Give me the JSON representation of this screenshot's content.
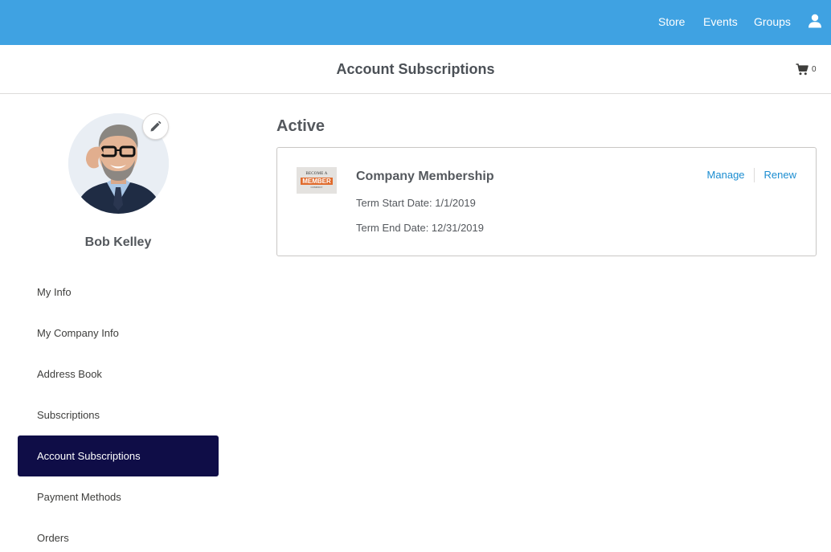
{
  "topnav": {
    "links": [
      "Store",
      "Events",
      "Groups"
    ],
    "user_icon": "user-icon",
    "color": "#3fa2e2"
  },
  "header": {
    "title": "Account Subscriptions",
    "cart_icon": "cart-icon",
    "cart_count": "0"
  },
  "profile": {
    "name": "Bob Kelley",
    "edit_icon": "pencil-icon"
  },
  "sidebar": {
    "items": [
      {
        "label": "My Info"
      },
      {
        "label": "My Company Info"
      },
      {
        "label": "Address Book"
      },
      {
        "label": "Subscriptions"
      },
      {
        "label": "Account Subscriptions"
      },
      {
        "label": "Payment Methods"
      },
      {
        "label": "Orders"
      }
    ],
    "active_color": "#0f0d47"
  },
  "main": {
    "section_title": "Active",
    "subscription": {
      "thumb": {
        "line1": "BECOME A",
        "line2": "MEMBER",
        "line3": "COMPANY"
      },
      "name": "Company Membership",
      "term_start": "Term Start Date: 1/1/2019",
      "term_end": "Term End Date: 12/31/2019",
      "manage_label": "Manage",
      "renew_label": "Renew"
    }
  }
}
